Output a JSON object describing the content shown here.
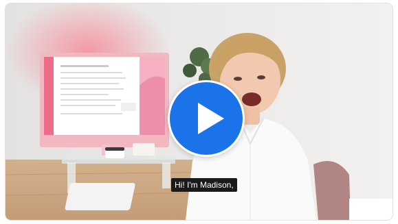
{
  "video": {
    "caption": "Hi! I'm Madison,",
    "play_icon": "play-icon",
    "play_button_color": "#1a73e8"
  }
}
